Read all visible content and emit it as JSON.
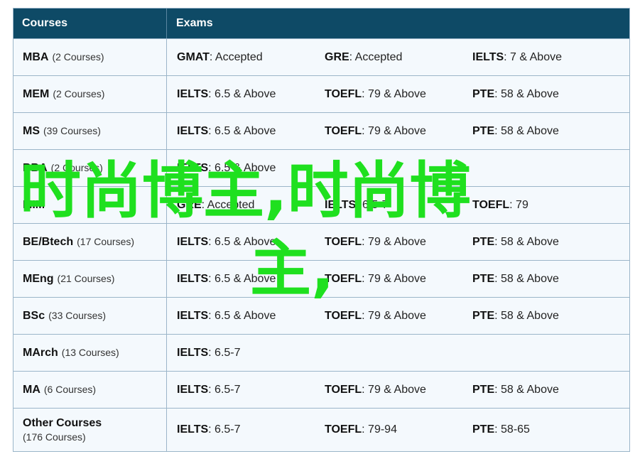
{
  "header": {
    "courses": "Courses",
    "exams": "Exams"
  },
  "rows": [
    {
      "course": "MBA",
      "count": "(2 Courses)",
      "exams": [
        {
          "name": "GMAT",
          "score": ": Accepted"
        },
        {
          "name": "GRE",
          "score": ": Accepted"
        },
        {
          "name": "IELTS",
          "score": ": 7 & Above"
        }
      ]
    },
    {
      "course": "MEM",
      "count": "(2 Courses)",
      "exams": [
        {
          "name": "IELTS",
          "score": ": 6.5 & Above"
        },
        {
          "name": "TOEFL",
          "score": ": 79 & Above"
        },
        {
          "name": "PTE",
          "score": ": 58 & Above"
        }
      ]
    },
    {
      "course": "MS",
      "count": "(39 Courses)",
      "exams": [
        {
          "name": "IELTS",
          "score": ": 6.5 & Above"
        },
        {
          "name": "TOEFL",
          "score": ": 79 & Above"
        },
        {
          "name": "PTE",
          "score": ": 58 & Above"
        }
      ]
    },
    {
      "course": "BBA",
      "count": "(2 Courses)",
      "exams": [
        {
          "name": "IELTS",
          "score": ": 6.5 & Above"
        }
      ]
    },
    {
      "course": "MIM",
      "count": "",
      "exams": [
        {
          "name": "GRE",
          "score": ": Accepted"
        },
        {
          "name": "IELTS",
          "score": ": 6.5-7"
        },
        {
          "name": "TOEFL",
          "score": ": 79"
        }
      ]
    },
    {
      "course": "BE/Btech",
      "count": "(17 Courses)",
      "exams": [
        {
          "name": "IELTS",
          "score": ": 6.5 & Above"
        },
        {
          "name": "TOEFL",
          "score": ": 79 & Above"
        },
        {
          "name": "PTE",
          "score": ": 58 & Above"
        }
      ]
    },
    {
      "course": "MEng",
      "count": "(21 Courses)",
      "exams": [
        {
          "name": "IELTS",
          "score": ": 6.5 & Above"
        },
        {
          "name": "TOEFL",
          "score": ": 79 & Above"
        },
        {
          "name": "PTE",
          "score": ": 58 & Above"
        }
      ]
    },
    {
      "course": "BSc",
      "count": "(33 Courses)",
      "exams": [
        {
          "name": "IELTS",
          "score": ": 6.5 & Above"
        },
        {
          "name": "TOEFL",
          "score": ": 79 & Above"
        },
        {
          "name": "PTE",
          "score": ": 58 & Above"
        }
      ]
    },
    {
      "course": "MArch",
      "count": "(13 Courses)",
      "exams": [
        {
          "name": "IELTS",
          "score": ": 6.5-7"
        }
      ]
    },
    {
      "course": "MA",
      "count": "(6 Courses)",
      "exams": [
        {
          "name": "IELTS",
          "score": ": 6.5-7"
        },
        {
          "name": "TOEFL",
          "score": ": 79 & Above"
        },
        {
          "name": "PTE",
          "score": ": 58 & Above"
        }
      ]
    },
    {
      "course": "Other Courses",
      "count": "(176 Courses)",
      "count_on_new_line": true,
      "exams": [
        {
          "name": "IELTS",
          "score": ": 6.5-7"
        },
        {
          "name": "TOEFL",
          "score": ": 79-94"
        },
        {
          "name": "PTE",
          "score": ": 58-65"
        }
      ]
    }
  ],
  "watermark": {
    "line1": "时尚博主,时尚博",
    "line2": "主,"
  },
  "colors": {
    "header_bg": "#0e4a66",
    "row_bg": "#f4f9fd",
    "border": "#9bb5c9",
    "watermark": "#1fe01f"
  }
}
